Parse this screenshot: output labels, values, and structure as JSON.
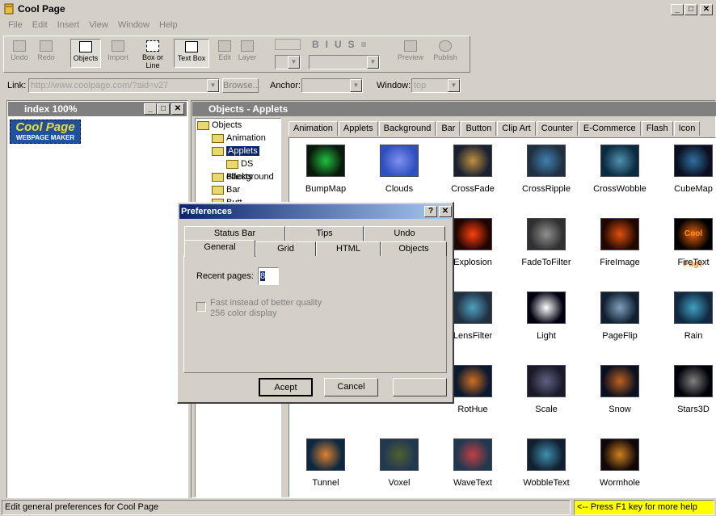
{
  "window": {
    "title": "Cool Page"
  },
  "menu": [
    "File",
    "Edit",
    "Insert",
    "View",
    "Window",
    "Help"
  ],
  "toolbar": {
    "undo": "Undo",
    "redo": "Redo",
    "objects": "Objects",
    "import": "Import",
    "box_or_line": "Box or Line",
    "text_box": "Text Box",
    "edit": "Edit",
    "layer": "Layer",
    "preview": "Preview",
    "publish": "Publish"
  },
  "linkbar": {
    "link_label": "Link:",
    "link_value": "http://www.coolpage.com/?aid=v27",
    "browse": "Browse...",
    "anchor_label": "Anchor:",
    "window_label": "Window:",
    "window_value": "top"
  },
  "index_window": {
    "title": "index  100%",
    "logo_top": "Cool Page",
    "logo_bottom": "WEBPAGE MAKER"
  },
  "objects_window": {
    "title": "Objects - Applets"
  },
  "tabs": [
    "Animation",
    "Applets",
    "Background",
    "Bar",
    "Button",
    "Clip Art",
    "Counter",
    "E-Commerce",
    "Flash",
    "Icon"
  ],
  "tree": [
    "Objects",
    "Animation",
    "Applets",
    "DS effects",
    "Background",
    "Bar",
    "Butt"
  ],
  "applets": [
    "BumpMap",
    "Clouds",
    "CrossFade",
    "CrossRipple",
    "CrossWobble",
    "CubeMap",
    "Explosion",
    "FadeToFilter",
    "FireImage",
    "FireText",
    "LensFilter",
    "Light",
    "PageFlip",
    "Rain",
    "RotHue",
    "Scale",
    "Snow",
    "Stars3D",
    "Tunnel",
    "Voxel",
    "WaveText",
    "WobbleText",
    "Wormhole"
  ],
  "firetext_label": "Cool Page",
  "dialog": {
    "title": "Preferences",
    "tabs_back": [
      "Status Bar",
      "Tips",
      "Undo"
    ],
    "tabs_front": [
      "General",
      "Grid",
      "HTML",
      "Objects"
    ],
    "recent_label": "Recent pages:",
    "recent_value": "8",
    "fast_line1": "Fast instead of better quality",
    "fast_line2": "256 color display",
    "accept": "Acept",
    "cancel": "Cancel",
    "help_btn": "?",
    "close_btn": "✕"
  },
  "status": {
    "text": "Edit general preferences for Cool Page",
    "hint": "<-- Press F1 key for more help"
  },
  "colors": {
    "title_gradient_start": "#0a246a",
    "title_gradient_end": "#a6caf0",
    "hint_bg": "#ffff00"
  }
}
